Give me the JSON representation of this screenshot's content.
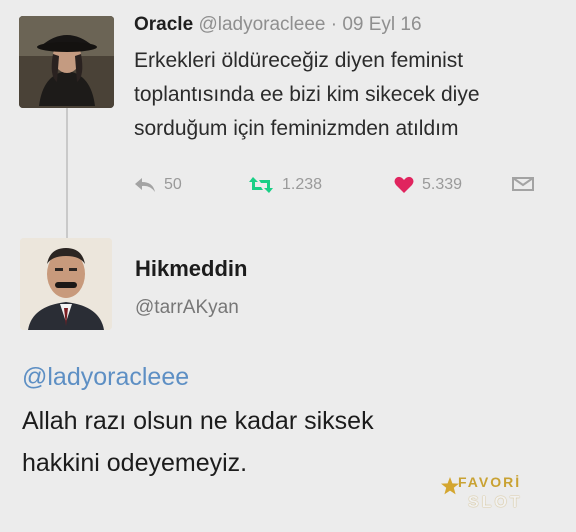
{
  "tweet1": {
    "name": "Oracle",
    "meta": "@ladyoracleee · 09 Eyl 16",
    "lines": [
      "Erkekleri öldüreceğiz diyen feminist",
      "toplantısında ee bizi kim sikecek diye",
      "sorduğum için feminizmden atıldım"
    ],
    "actions": {
      "reply_count": "50",
      "retweet_count": "1.238",
      "like_count": "5.339"
    },
    "icons": [
      "reply-icon",
      "retweet-icon",
      "heart-icon",
      "message-icon"
    ],
    "colors": {
      "retweet": "#19cf86",
      "like": "#e0245e"
    }
  },
  "tweet2": {
    "name": "Hikmeddin",
    "handle": "@tarrAKyan",
    "mention": "@ladyoracleee",
    "lines": [
      "Allah razı olsun ne kadar siksek",
      "hakkini odeyemeyiz."
    ]
  },
  "watermark": {
    "top": "FAVORİ",
    "bottom": "SLOT"
  }
}
